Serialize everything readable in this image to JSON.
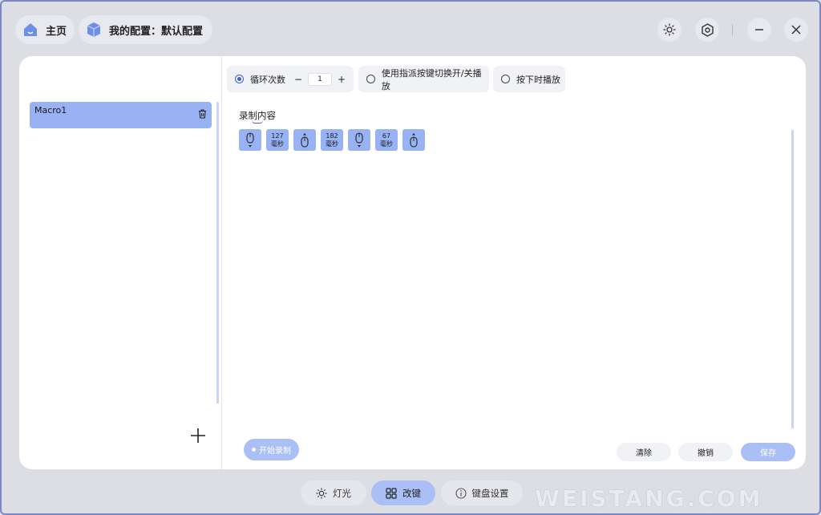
{
  "header": {
    "home_label": "主页",
    "profile_label": "我的配置：默认配置",
    "icons": [
      "home-icon",
      "cube-icon",
      "brightness-icon",
      "settings-hex-icon",
      "minimize-icon",
      "close-icon"
    ]
  },
  "sidebar": {
    "macros": [
      {
        "name": "Macro1"
      }
    ]
  },
  "options": {
    "loop_label": "循环次数",
    "loop_count": "1",
    "stepper_minus": "−",
    "stepper_plus": "+",
    "toggle_label": "使用指派按键切换开/关播放",
    "hold_label": "按下时播放"
  },
  "recording": {
    "title": "录制内容",
    "events": [
      {
        "type": "mouse",
        "dir": "down"
      },
      {
        "type": "delay",
        "value": "127",
        "unit": "毫秒"
      },
      {
        "type": "mouse",
        "dir": "up"
      },
      {
        "type": "delay",
        "value": "182",
        "unit": "毫秒"
      },
      {
        "type": "mouse",
        "dir": "down"
      },
      {
        "type": "delay",
        "value": "67",
        "unit": "毫秒"
      },
      {
        "type": "mouse",
        "dir": "up"
      }
    ]
  },
  "actions": {
    "start_record": "开始录制",
    "clear": "清除",
    "undo": "撤销",
    "save": "保存"
  },
  "tabs": [
    {
      "label": "灯光",
      "icon": "light-icon",
      "active": false
    },
    {
      "label": "改键",
      "icon": "grid-icon",
      "active": true
    },
    {
      "label": "键盘设置",
      "icon": "info-icon",
      "active": false
    }
  ],
  "watermark": "WEISTANG.COM",
  "colors": {
    "accent": "#3a63d8",
    "selection": "#98b2f3",
    "button_primary": "#a9bff5"
  }
}
